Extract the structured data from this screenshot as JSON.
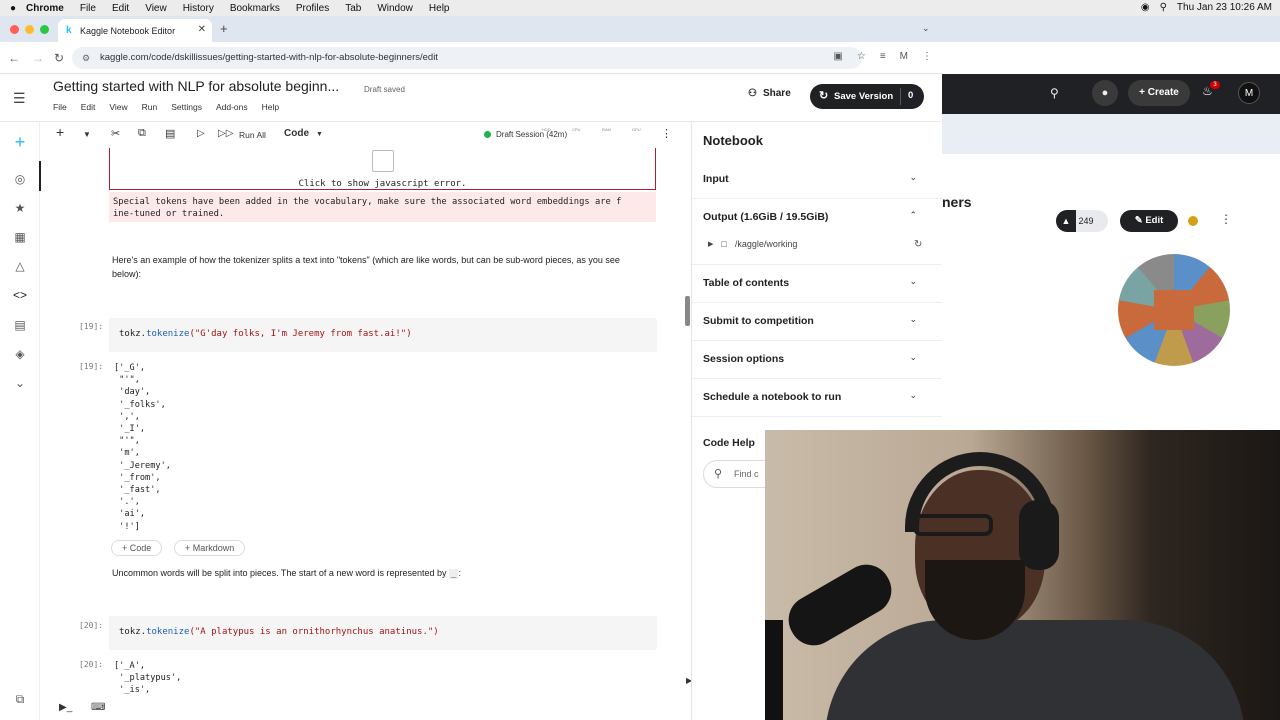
{
  "menubar": {
    "apple": "",
    "app": "Chrome",
    "items": [
      "File",
      "Edit",
      "View",
      "History",
      "Bookmarks",
      "Profiles",
      "Tab",
      "Window",
      "Help"
    ],
    "clock": "Thu Jan 23  10:26 AM"
  },
  "browser": {
    "tab_title": "Kaggle Notebook Editor",
    "url": "kaggle.com/code/dskillissues/getting-started-with-nlp-for-absolute-beginners/edit"
  },
  "header": {
    "title": "Getting started with NLP for absolute beginn...",
    "draft_status": "Draft saved",
    "menu": [
      "File",
      "Edit",
      "View",
      "Run",
      "Settings",
      "Add-ons",
      "Help"
    ],
    "share_label": "Share",
    "save_label": "Save Version",
    "save_count": "0"
  },
  "toolbar": {
    "run_all": "Run All",
    "cell_type": "Code",
    "session": "Draft Session (42m)",
    "meters": [
      "HDD",
      "CPU",
      "RAM",
      "GPU"
    ]
  },
  "notebook": {
    "js_error": "Click to show javascript error.",
    "warning": "Special tokens have been added in the vocabulary, make sure the associated word embeddings are f\nine-tuned or trained.",
    "md1": "Here's an example of how the tokenizer splits a text into \"tokens\" (which are like words, but can be sub-word pieces, as you see below):",
    "cell19_num": "[19]:",
    "cell19_code_prefix": "tokz.",
    "cell19_code_fn": "tokenize",
    "cell19_code_args": "(\"G'day folks, I'm Jeremy from fast.ai!\")",
    "out19_num": "[19]:",
    "out19": "['_G',\n \"'\",\n 'day',\n '_folks',\n ',',\n '_I',\n \"'\",\n 'm',\n '_Jeremy',\n '_from',\n '_fast',\n '.',\n 'ai',\n '!']",
    "add_code": "+ Code",
    "add_markdown": "+ Markdown",
    "md2": "Uncommon words will be split into pieces. The start of a new word is represented by",
    "md2_code": "_",
    "cell20_num": "[20]:",
    "cell20_code_prefix": "tokz.",
    "cell20_code_fn": "tokenize",
    "cell20_code_args": "(\"A platypus is an ornithorhynchus anatinus.\")",
    "out20_num": "[20]:",
    "out20": "['_A',\n '_platypus',\n '_is',"
  },
  "panel": {
    "title": "Notebook",
    "sections": [
      {
        "label": "Input",
        "expanded": false
      },
      {
        "label": "Output (1.6GiB / 19.5GiB)",
        "expanded": true
      },
      {
        "label": "Table of contents",
        "expanded": false
      },
      {
        "label": "Submit to competition",
        "expanded": false
      },
      {
        "label": "Session options",
        "expanded": false
      },
      {
        "label": "Schedule a notebook to run",
        "expanded": false
      }
    ],
    "output_folder": "/kaggle/working",
    "code_help": "Code Help",
    "find_placeholder": "Find c"
  },
  "window2": {
    "create": "Create",
    "notif_count": "3",
    "avatar": "M",
    "heading_fragment": "ners",
    "upvotes": "249",
    "edit": "Edit"
  },
  "colors": {
    "kaggle_blue": "#20beff",
    "dark": "#202124",
    "error_red": "#b0202c",
    "warn_bg": "#fde9ea",
    "session_green": "#1eaf4f"
  }
}
